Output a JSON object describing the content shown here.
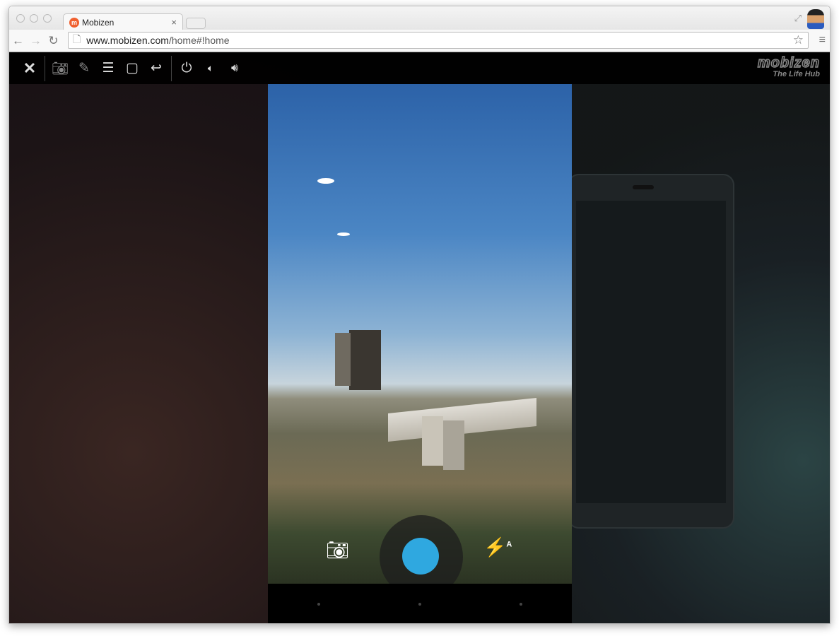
{
  "browser": {
    "tab_title": "Mobizen",
    "favicon": "m",
    "url_host": "www.mobizen.com",
    "url_path": "/home#!home"
  },
  "toolbar": {
    "icons": [
      "close-icon",
      "camera-icon",
      "pencil-icon",
      "menu-icon",
      "square-icon",
      "back-icon",
      "power-icon",
      "volume-down-icon",
      "volume-up-icon"
    ]
  },
  "logo": {
    "name": "mobizen",
    "tagline": "The Life Hub"
  },
  "camera": {
    "shutter_color": "#2fa8e0",
    "flash_mode": "A"
  }
}
